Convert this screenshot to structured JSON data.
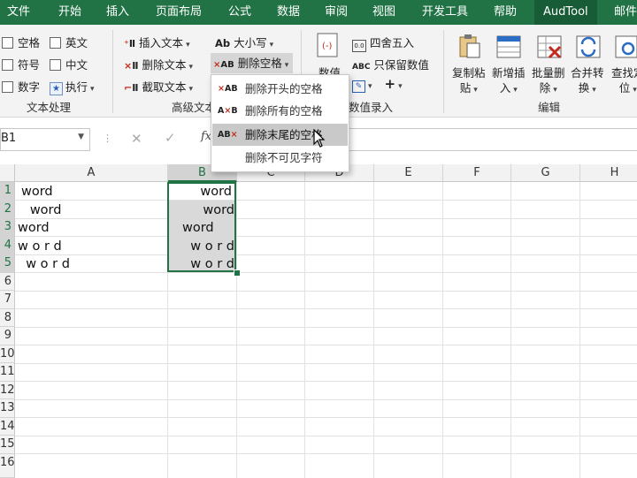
{
  "menu": [
    "文件",
    "开始",
    "插入",
    "页面布局",
    "公式",
    "数据",
    "审阅",
    "视图",
    "开发工具",
    "帮助",
    "AudTool",
    "邮件"
  ],
  "ribbon": {
    "text_group": {
      "items": [
        "空格",
        "英文",
        "符号",
        "中文",
        "数字",
        "执行"
      ],
      "label": "文本处理"
    },
    "advanced_group": {
      "insert_text": "插入文本",
      "delete_text": "删除文本",
      "extract_text": "截取文本",
      "case": "大小写",
      "delete_spaces": "删除空格",
      "label_partial": "高级文本"
    },
    "number_group": {
      "numeric_partial": "数值",
      "round": "四舍五入",
      "keep_numbers": "只保留数值",
      "label_partial": "数值录入"
    },
    "edit_group": {
      "buttons": [
        {
          "line1": "复制粘",
          "line2": "贴"
        },
        {
          "line1": "新增插",
          "line2": "入"
        },
        {
          "line1": "批量删",
          "line2": "除"
        },
        {
          "line1": "合并转",
          "line2": "换"
        },
        {
          "line1": "查找定",
          "line2": "位"
        }
      ],
      "label": "编辑"
    }
  },
  "formula_bar": {
    "cell_ref": "B1",
    "fx": "fx"
  },
  "dropdown": {
    "items": [
      "删除开头的空格",
      "删除所有的空格",
      "删除末尾的空格",
      "删除不可见字符"
    ],
    "hovered_index": 2
  },
  "columns": [
    "A",
    "B",
    "C",
    "D",
    "E",
    "F",
    "G",
    "H"
  ],
  "rows": [
    "1",
    "2",
    "3",
    "4",
    "5",
    "6",
    "7",
    "8",
    "9",
    "10",
    "11",
    "12",
    "13",
    "14",
    "15",
    "16"
  ],
  "cells_a": [
    "word",
    "   word",
    "word",
    "w o r d",
    "  w o r d"
  ],
  "cells_b": [
    "word",
    "word",
    "word",
    "w o r d",
    "w o r d"
  ],
  "colors": {
    "accent": "#217346",
    "red_icon": "#c42b1c"
  }
}
